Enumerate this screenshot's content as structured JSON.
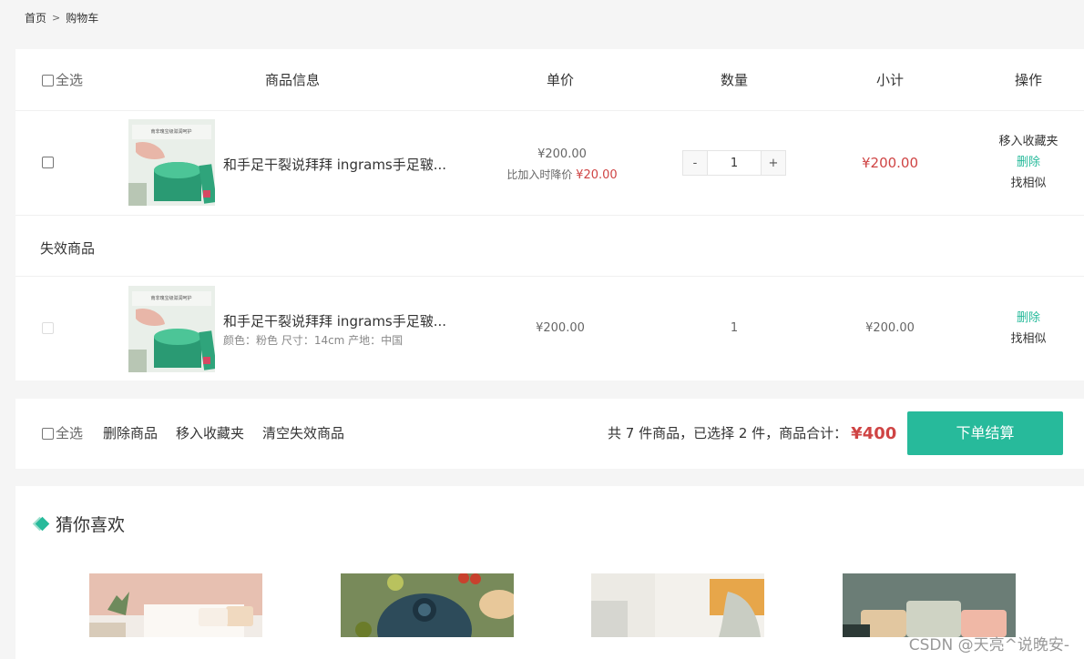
{
  "breadcrumb": {
    "home": "首页",
    "separator": ">",
    "current": "购物车"
  },
  "cart": {
    "headers": {
      "select_all": "全选",
      "info": "商品信息",
      "price": "单价",
      "quantity": "数量",
      "subtotal": "小计",
      "actions": "操作"
    },
    "items": [
      {
        "name": "和手足干裂说拜拜 ingrams手足皲...",
        "price": "¥200.00",
        "price_drop_label": "比加入时降价",
        "price_drop_value": "¥20.00",
        "quantity_minus": "-",
        "quantity": "1",
        "quantity_plus": "+",
        "subtotal": "¥200.00",
        "action_fav": "移入收藏夹",
        "action_delete": "删除",
        "action_similar": "找相似"
      }
    ],
    "invalid_section_title": "失效商品",
    "invalid_items": [
      {
        "name": "和手足干裂说拜拜 ingrams手足皲...",
        "attrs": "颜色：粉色 尺寸：14cm 产地：中国",
        "price": "¥200.00",
        "quantity": "1",
        "subtotal": "¥200.00",
        "action_delete": "删除",
        "action_similar": "找相似"
      }
    ]
  },
  "footer": {
    "select_all": "全选",
    "delete_goods": "删除商品",
    "move_to_fav": "移入收藏夹",
    "clear_invalid": "清空失效商品",
    "summary": "共 7 件商品，已选择 2 件，商品合计：",
    "total": "¥400",
    "checkout": "下单结算"
  },
  "recommend": {
    "title": "猜你喜欢"
  },
  "watermark": "CSDN @天亮^说晚安-",
  "colors": {
    "accent": "#27ba9b",
    "price_red": "#cf4444",
    "background": "#f5f5f5"
  }
}
